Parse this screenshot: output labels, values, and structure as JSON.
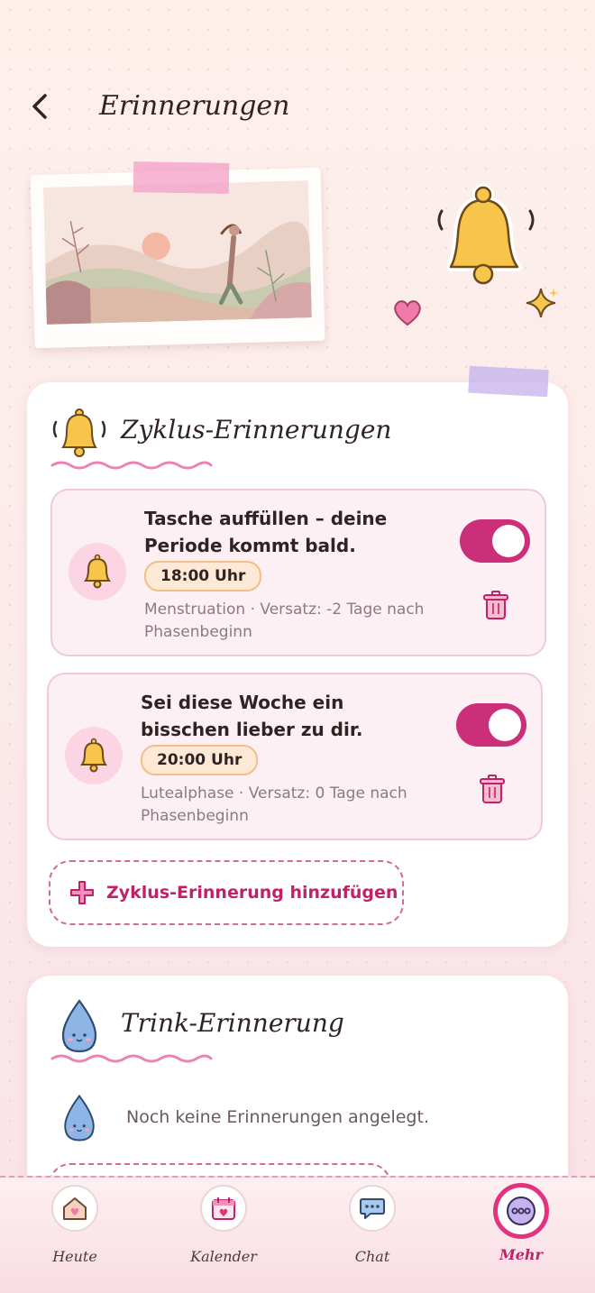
{
  "header": {
    "title": "Erinnerungen"
  },
  "cycle_card": {
    "title": "Zyklus-Erinnerungen",
    "reminders": [
      {
        "title": "Tasche auffüllen – deine Periode kommt bald.",
        "time": "18:00 Uhr",
        "meta": "Menstruation · Versatz: -2 Tage nach Phasenbeginn",
        "enabled": true
      },
      {
        "title": "Sei diese Woche ein bisschen lieber zu dir.",
        "time": "20:00 Uhr",
        "meta": "Lutealphase · Versatz: 0 Tage nach Phasenbeginn",
        "enabled": true
      }
    ],
    "add_label": "Zyklus-Erinnerung hinzufügen"
  },
  "drink_card": {
    "title": "Trink-Erinnerung",
    "empty_text": "Noch keine Erinnerungen angelegt."
  },
  "nav": {
    "items": [
      {
        "label": "Heute",
        "icon": "house-icon"
      },
      {
        "label": "Kalender",
        "icon": "calendar-icon"
      },
      {
        "label": "Chat",
        "icon": "chat-bubble-icon"
      },
      {
        "label": "Mehr",
        "icon": "more-dots-icon"
      }
    ],
    "active": "Mehr"
  },
  "colors": {
    "accent": "#cc2f7a",
    "accent_dark": "#c0226a",
    "time_badge": "#fde9d6",
    "card_bg": "#ffffff",
    "reminder_bg": "#fdf0f4"
  }
}
